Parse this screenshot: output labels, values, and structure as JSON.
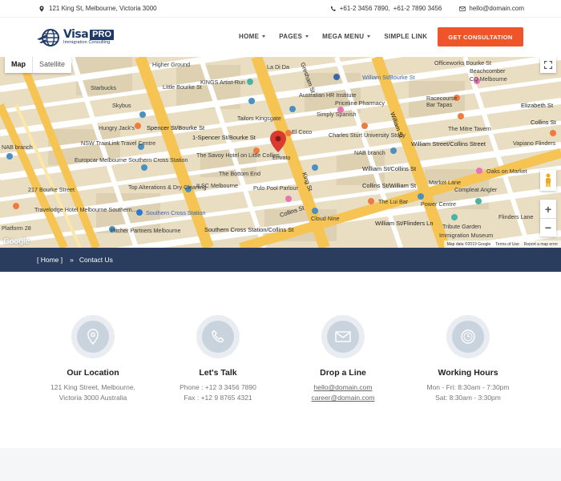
{
  "topbar": {
    "address": "121 King St, Melbourne, Victoria 3000",
    "phone1": "+61-2 3456 7890,",
    "phone2": "+61-2 7890 3456",
    "email": "hello@domain.com"
  },
  "logo": {
    "brand": "Visa",
    "badge": "PRO",
    "tagline": "Immigration Consulting"
  },
  "nav": {
    "items": [
      {
        "label": "HOME",
        "dropdown": true
      },
      {
        "label": "PAGES",
        "dropdown": true
      },
      {
        "label": "MEGA MENU",
        "dropdown": true
      },
      {
        "label": "SIMPLE LINK",
        "dropdown": false
      }
    ],
    "cta": "GET CONSULTATION"
  },
  "map": {
    "type_map": "Map",
    "type_satellite": "Satellite",
    "zoom_in": "+",
    "zoom_out": "−",
    "google": "Google",
    "footer": [
      "Map data ©2019 Google",
      "Terms of Use",
      "Report a map error"
    ],
    "labels": {
      "higher_ground": "Higher Ground",
      "la_di_da": "La Di Da",
      "officeworks": "Officeworks Bourke St",
      "little_bourke": "Little Bourke St",
      "kings_artist": "KINGS Artist-Run",
      "gresham": "Gresham St",
      "william_bourke": "William St/Bourke St",
      "beachcomber": "Beachcomber",
      "cq_melbourne": "CQ Melbourne",
      "starbucks": "Starbucks",
      "australian_hr": "Australian HR Institute",
      "priceline": "Priceline Pharmacy",
      "racecourse": "Racecourse",
      "skybus": "Skybus",
      "simply_spanish": "Simply Spanish",
      "bar_tapas": "Bar Tapas",
      "elizabeth_st": "Elizabeth St",
      "hungry_jacks": "Hungry Jack's",
      "spencer_bourke": "Spencer St/Bourke St",
      "tailors_kingsgate": "Tailors Kingsgate",
      "el_coco": "El Coco",
      "charles_sturt": "Charles Sturt University Study",
      "william_st": "William St",
      "mitre_tavern": "The Mitre Tavern",
      "collins_st_right": "Collins St",
      "nab_branch_left": "NAB branch",
      "nsw_trainlink": "NSW TrainLink Travel Centre",
      "spencer_bourke_2": "1-Spencer St/Bourke St",
      "william_collins": "William Street/Collins Street",
      "vapiano": "Vapiano Flinders",
      "europcar": "Europcar Melbourne Southern Cross Station",
      "savoy": "The Savoy Hotel on Little Collins...",
      "nab_branch_right": "NAB branch",
      "envato": "Envato",
      "william_collins_2": "William St/Collins St",
      "oaks_market": "Oaks on Market",
      "bottom_end": "The Bottom End",
      "top_alterations": "Top Alterations & Dry Cleaning",
      "ilsc": "ILSC Melbourne",
      "pulo_pool": "Pulo Pool Parlour",
      "collins_william": "Collins St/William St",
      "compleat_angler": "Compleat Angler",
      "melbourne_217": "217 Bourke Street",
      "king_st": "King St",
      "power_centre": "Power Centre",
      "southern_cross": "Southern Cross Station",
      "lui_bar": "The Lui Bar",
      "market_lane": "Market Lane",
      "travelodge": "Travelodge Hotel Melbourne Southern...",
      "cloud_nine": "Cloud Nine",
      "william_flinders": "William St/Flinders Ln",
      "flinders_lane": "Flinders Lane",
      "platform_28": "Platform 28",
      "pitcher_partners": "Pitcher Partners Melbourne",
      "collins_st_bottom": "Collins St",
      "southern_cross_collins": "Southern Cross Station/Collins St",
      "immigration_museum": "Immigration Museum",
      "tribute_garden": "Tribute Garden",
      "collins_st_map": "Collins St"
    }
  },
  "breadcrumb": {
    "home": "[ Home ]",
    "separator": "»",
    "current": "Contact Us"
  },
  "contact": [
    {
      "title": "Our Location",
      "line1": "121 King Street, Melbourne,",
      "line2": "Victoria 3000 Australia",
      "icon": "location-pin-icon"
    },
    {
      "title": "Let's Talk",
      "line1": "Phone : +12 3 3456 7890",
      "line2": "Fax : +12 9 8765 4321",
      "icon": "phone-icon"
    },
    {
      "title": "Drop a Line",
      "line1": "hello@domain.com",
      "line2": "career@domain.com",
      "icon": "envelope-icon"
    },
    {
      "title": "Working Hours",
      "line1": "Mon - Fri: 8:30am - 7:30pm",
      "line2": "Sat: 8:30am - 3:30pm",
      "icon": "clock-icon"
    }
  ],
  "colors": {
    "brand_navy": "#1f3a66",
    "cta_orange": "#f0542a",
    "breadcrumb_bg": "#2a3d5f",
    "map_road_yellow": "#f5c452"
  }
}
